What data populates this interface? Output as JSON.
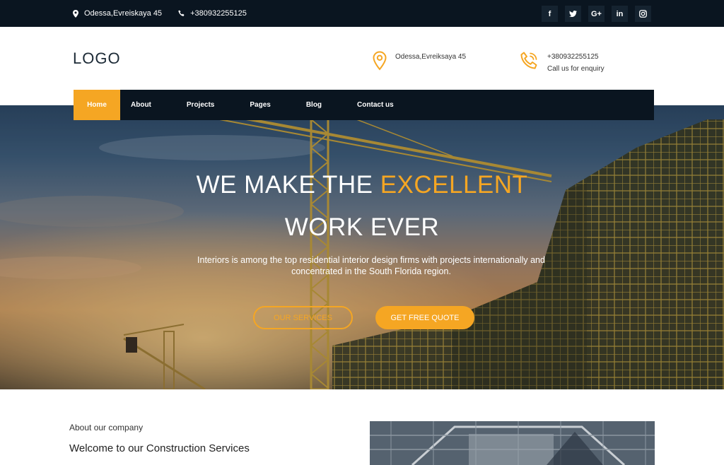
{
  "topbar": {
    "address": "Odessa,Evreiskaya 45",
    "phone": "+380932255125",
    "social": [
      {
        "icon": "facebook-icon",
        "glyph": "f"
      },
      {
        "icon": "twitter-icon",
        "glyph": "t"
      },
      {
        "icon": "google-plus-icon",
        "glyph": "G+"
      },
      {
        "icon": "linkedin-icon",
        "glyph": "in"
      },
      {
        "icon": "instagram-icon",
        "glyph": "◎"
      }
    ]
  },
  "header": {
    "logo": "LOGO",
    "address": "Odessa,Evreiksaya 45",
    "phone": "+380932255125",
    "phone_caption": "Call us for enquiry"
  },
  "nav": {
    "items": [
      "Home",
      "About",
      "Projects",
      "Pages",
      "Blog",
      "Contact us"
    ],
    "active": "Home"
  },
  "hero": {
    "title_prefix": "WE MAKE THE",
    "title_accent": "EXCELLENT",
    "title_line2": "WORK EVER",
    "description": "Interiors is among the top residential interior design firms with projects internationally and concentrated in the South Florida region.",
    "btn_services": "OUR SERVICES",
    "btn_quote": "GET FREE QUOTE"
  },
  "about": {
    "eyebrow": "About our company",
    "title": "Welcome to our Construction Services"
  },
  "colors": {
    "accent": "#f5a623",
    "dark": "#0a1520"
  }
}
